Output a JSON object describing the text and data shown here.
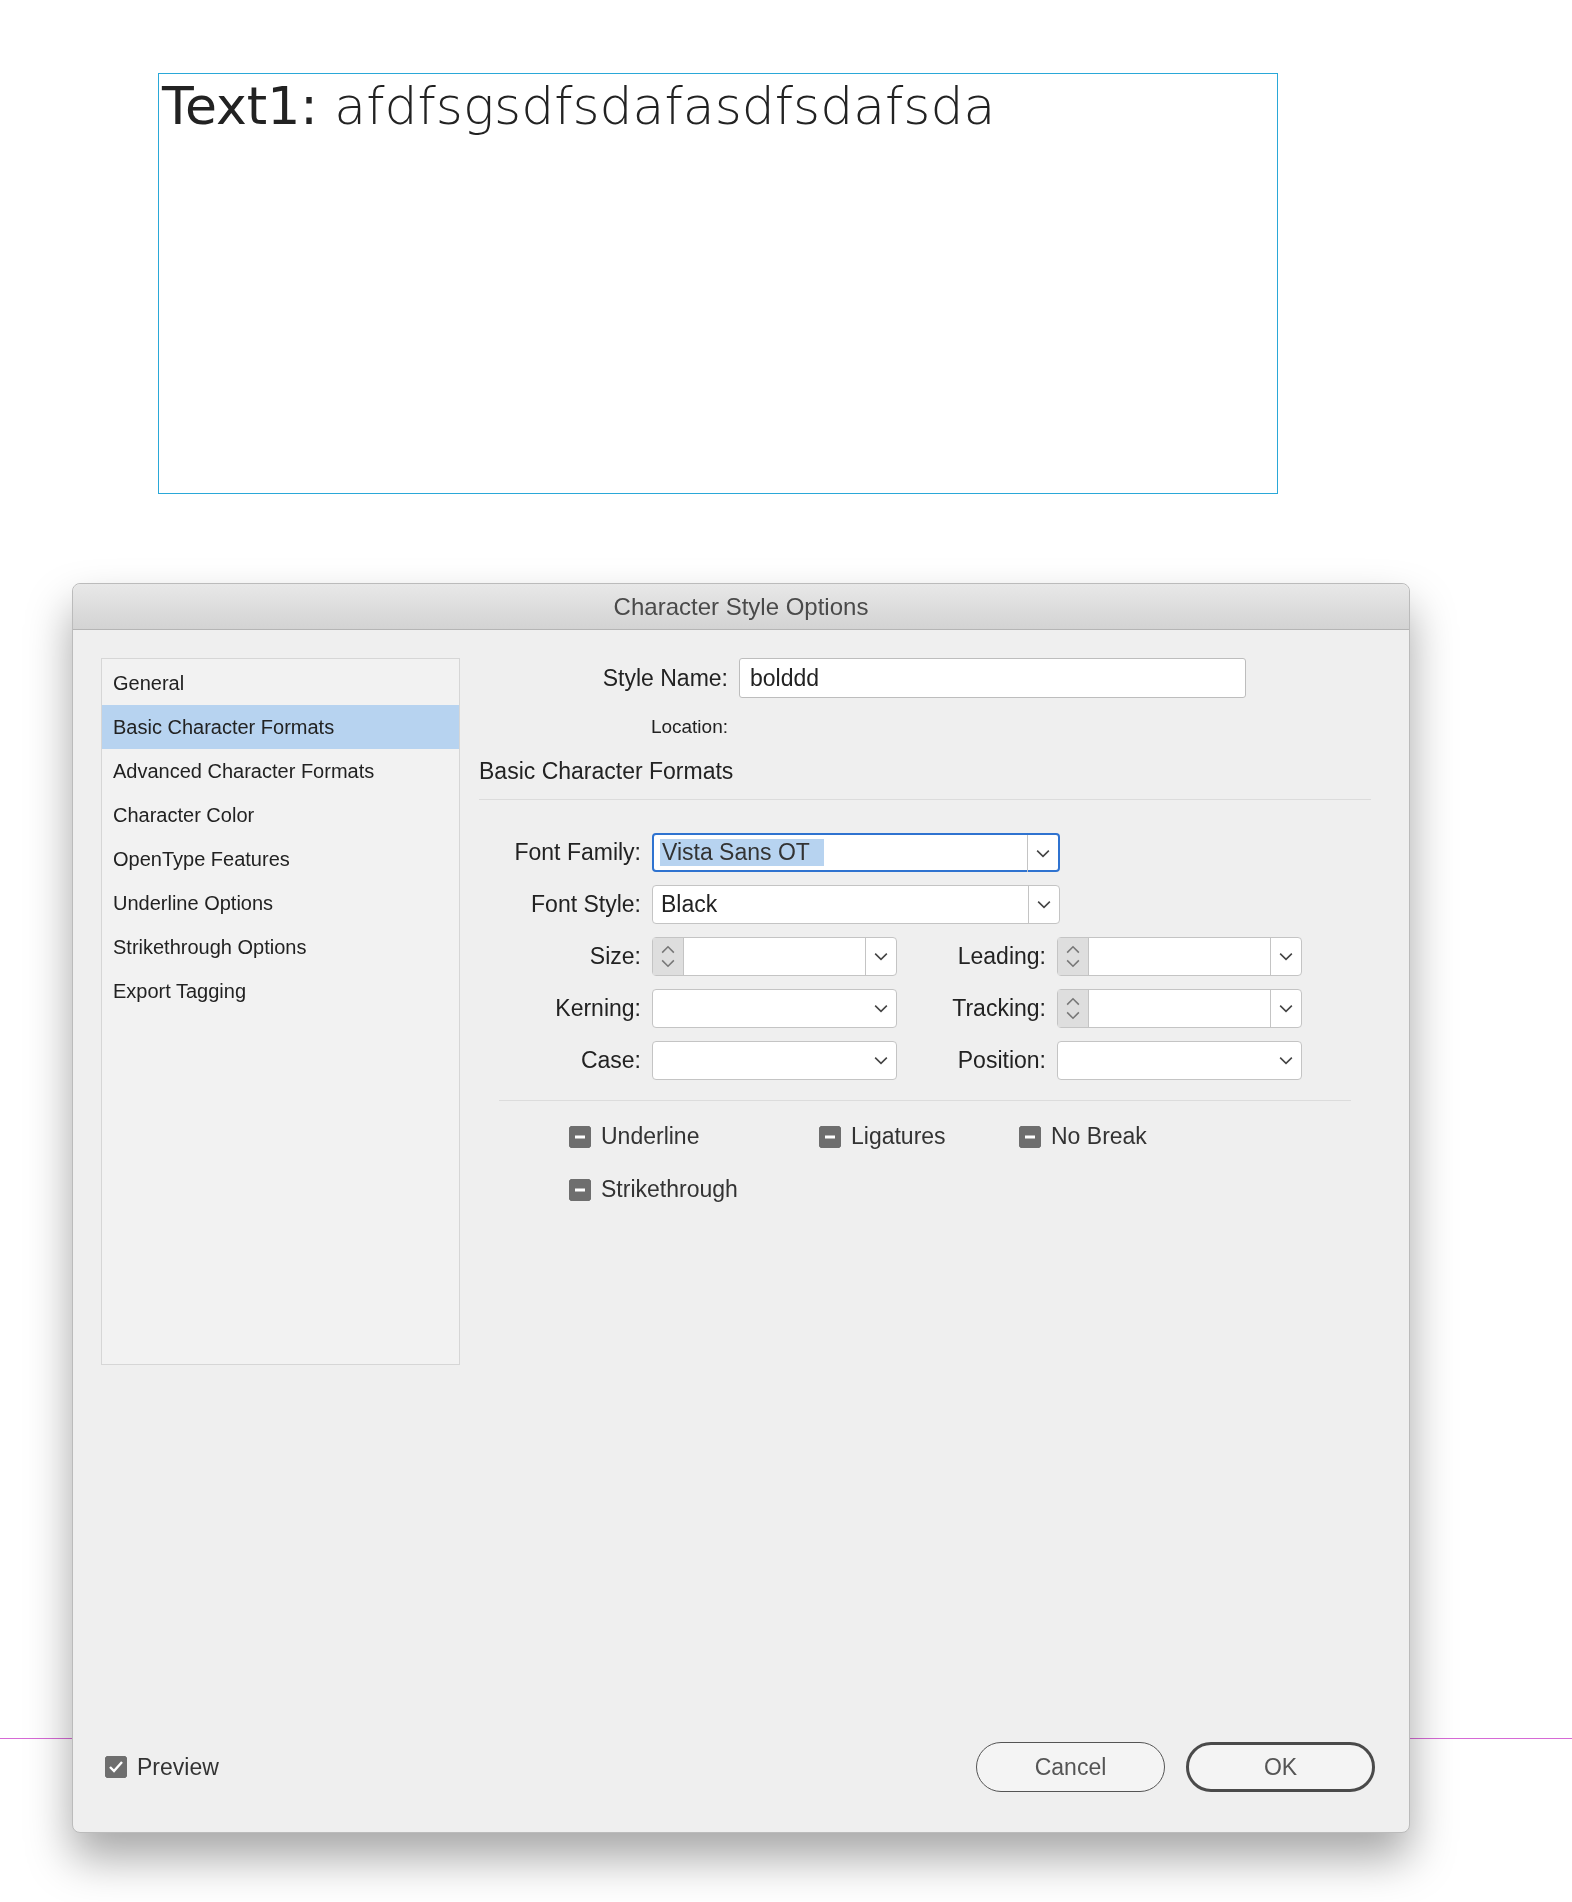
{
  "canvas": {
    "text_frame": {
      "text": "**Text1:** afdfsgsdfsdafasdfsdafsda"
    }
  },
  "dialog": {
    "title": "Character Style Options",
    "sidebar": [
      {
        "label": "General",
        "selected": false
      },
      {
        "label": "Basic Character Formats",
        "selected": true
      },
      {
        "label": "Advanced Character Formats",
        "selected": false
      },
      {
        "label": "Character Color",
        "selected": false
      },
      {
        "label": "OpenType Features",
        "selected": false
      },
      {
        "label": "Underline Options",
        "selected": false
      },
      {
        "label": "Strikethrough Options",
        "selected": false
      },
      {
        "label": "Export Tagging",
        "selected": false
      }
    ],
    "style_name": {
      "label": "Style Name:",
      "value": "bolddd"
    },
    "location_label": "Location:",
    "section_title": "Basic Character Formats",
    "rows": [
      {
        "fields": [
          {
            "label": "Font Family:",
            "kind": "combo",
            "value": "Vista Sans OT",
            "focused": true
          }
        ]
      },
      {
        "fields": [
          {
            "label": "Font Style:",
            "kind": "combo",
            "value": "Black",
            "focused": false
          }
        ]
      },
      {
        "fields": [
          {
            "label": "Size:",
            "kind": "spinner",
            "focused": false
          },
          {
            "label": "Leading:",
            "kind": "spinner",
            "focused": false
          }
        ]
      },
      {
        "fields": [
          {
            "label": "Kerning:",
            "kind": "select",
            "focused": false
          },
          {
            "label": "Tracking:",
            "kind": "spinner",
            "focused": false
          }
        ]
      },
      {
        "fields": [
          {
            "label": "Case:",
            "kind": "select",
            "focused": false
          },
          {
            "label": "Position:",
            "kind": "select",
            "focused": false
          }
        ]
      }
    ],
    "checkboxes": [
      {
        "label": "Underline",
        "checked": false,
        "mixed": true
      },
      {
        "label": "Ligatures",
        "checked": false,
        "mixed": true
      },
      {
        "label": "No Break",
        "checked": false,
        "mixed": true
      },
      {
        "label": "Strikethrough",
        "checked": false,
        "mixed": true
      }
    ],
    "preview": {
      "label": "Preview",
      "checked": true
    },
    "buttons": [
      {
        "label": "Cancel",
        "default": false
      },
      {
        "label": "OK",
        "default": true
      }
    ]
  }
}
